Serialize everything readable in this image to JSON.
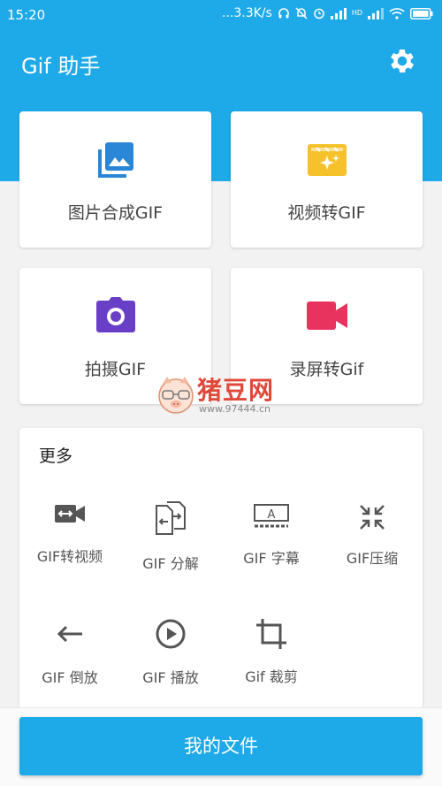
{
  "status_bar": {
    "time": "15:20",
    "network_speed": "...3.3K/s",
    "hd_label": "HD"
  },
  "app_bar": {
    "title": "Gif 助手",
    "settings_icon": "gear-icon"
  },
  "cards": [
    {
      "label": "图片合成GIF",
      "icon": "image-gallery-icon",
      "color": "#2a86d6"
    },
    {
      "label": "视频转GIF",
      "icon": "video-sparkle-icon",
      "color": "#f6c22b"
    },
    {
      "label": "拍摄GIF",
      "icon": "camera-icon",
      "color": "#6a3fc7"
    },
    {
      "label": "录屏转Gif",
      "icon": "video-camera-icon",
      "color": "#e9335f"
    }
  ],
  "more": {
    "title": "更多",
    "tools": [
      {
        "label": "GIF转视频",
        "icon": "gif-to-video-icon"
      },
      {
        "label": "GIF 分解",
        "icon": "split-icon"
      },
      {
        "label": "GIF 字幕",
        "icon": "subtitle-icon"
      },
      {
        "label": "GIF压缩",
        "icon": "compress-icon"
      },
      {
        "label": "GIF 倒放",
        "icon": "reverse-arrow-icon"
      },
      {
        "label": "GIF 播放",
        "icon": "play-circle-icon"
      },
      {
        "label": "Gif 裁剪",
        "icon": "crop-icon"
      }
    ]
  },
  "watermark": {
    "text": "猪豆网",
    "url": "www.97444.cn"
  },
  "bottom_button": {
    "label": "我的文件"
  },
  "colors": {
    "primary": "#1ea9e8",
    "icon_gray": "#555555"
  }
}
